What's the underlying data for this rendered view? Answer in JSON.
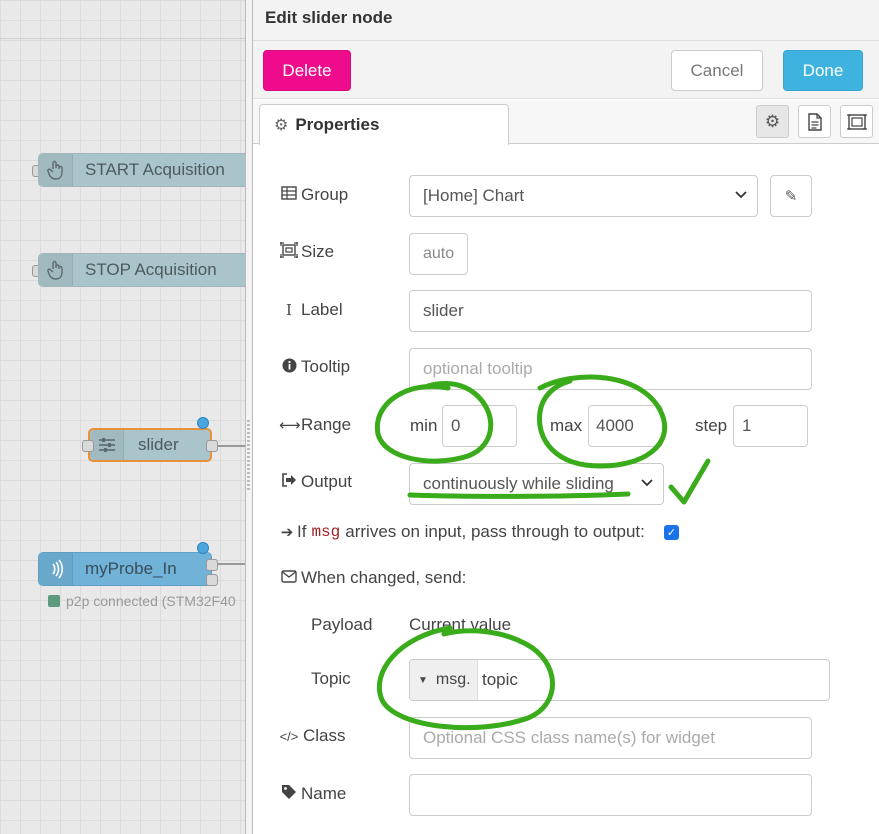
{
  "workspace": {
    "nodes": [
      {
        "id": "start",
        "label": "START Acquisition"
      },
      {
        "id": "stop",
        "label": "STOP Acquisition"
      },
      {
        "id": "slider",
        "label": "slider"
      },
      {
        "id": "probe",
        "label": "myProbe_In"
      }
    ],
    "probe_status": "p2p connected (STM32F40"
  },
  "tray": {
    "title": "Edit slider node",
    "buttons": {
      "delete": "Delete",
      "cancel": "Cancel",
      "done": "Done"
    },
    "tabs": {
      "properties": "Properties"
    }
  },
  "form": {
    "group": {
      "label": "Group",
      "value": "[Home] Chart"
    },
    "size": {
      "label": "Size",
      "value": "auto"
    },
    "label": {
      "label": "Label",
      "value": "slider"
    },
    "tooltip": {
      "label": "Tooltip",
      "placeholder": "optional tooltip"
    },
    "range": {
      "label": "Range",
      "min_label": "min",
      "min": "0",
      "max_label": "max",
      "max": "4000",
      "step_label": "step",
      "step": "1"
    },
    "output": {
      "label": "Output",
      "value": "continuously while sliding"
    },
    "passthrough": {
      "prefix": "If",
      "code": "msg",
      "suffix": "arrives on input, pass through to output:",
      "checked": true
    },
    "when_changed": {
      "label": "When changed, send:"
    },
    "payload": {
      "label": "Payload",
      "value": "Current value"
    },
    "topic": {
      "label": "Topic",
      "type": "msg.",
      "value": "topic"
    },
    "class": {
      "label": "Class",
      "placeholder": "Optional CSS class name(s) for widget"
    },
    "name": {
      "label": "Name",
      "value": ""
    }
  },
  "colors": {
    "delete": "#ee0c8d",
    "done": "#3fb3e0",
    "annotation": "#3aab1a",
    "node": "#a9c5cb",
    "node_selected_border": "#e8903a"
  }
}
